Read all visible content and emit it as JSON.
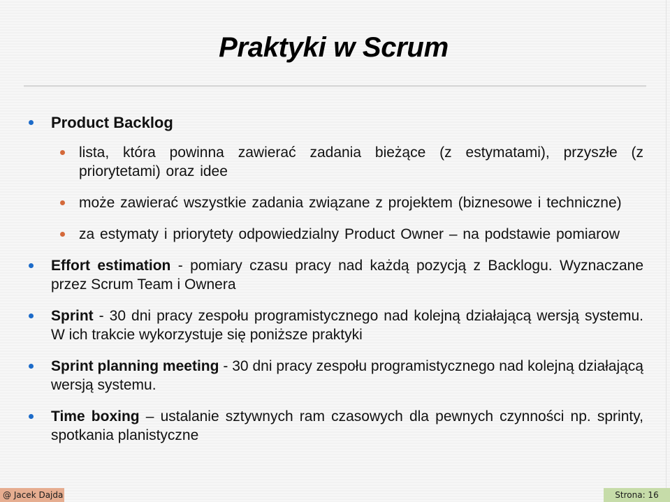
{
  "slide": {
    "title": "Praktyki w Scrum",
    "colors": {
      "primary_bullet": "#1c6bc9",
      "secondary_bullet": "#d4693a",
      "footer_author_bg": "#e6ad90",
      "footer_page_bg": "#c6dca9"
    },
    "product_backlog": {
      "heading": "Product Backlog",
      "subitems": [
        "lista, która powinna zawierać zadania bieżące (z estymatami), przyszłe (z priorytetami) oraz idee",
        "może zawierać wszystkie zadania związane z projektem (biznesowe i techniczne)",
        "za estymaty i priorytety odpowiedzialny Product Owner – na podstawie pomiarow"
      ]
    },
    "items": [
      {
        "term": "Effort estimation",
        "text": " - pomiary czasu pracy nad każdą pozycją z Backlogu. Wyznaczane przez Scrum Team i Ownera"
      },
      {
        "term": "Sprint",
        "text": " - 30 dni pracy zespołu programistycznego nad kolejną działającą wersją systemu. W ich trakcie wykorzystuje się poniższe praktyki"
      },
      {
        "term": "Sprint planning meeting",
        "text": " - 30 dni pracy zespołu programistycznego nad kolejną działającą wersją systemu."
      },
      {
        "term": "Time boxing",
        "text": " – ustalanie sztywnych ram czasowych dla pewnych czynności np. sprinty, spotkania planistyczne"
      }
    ]
  },
  "footer": {
    "author": "@ Jacek Dajda",
    "page": "Strona: 16"
  }
}
